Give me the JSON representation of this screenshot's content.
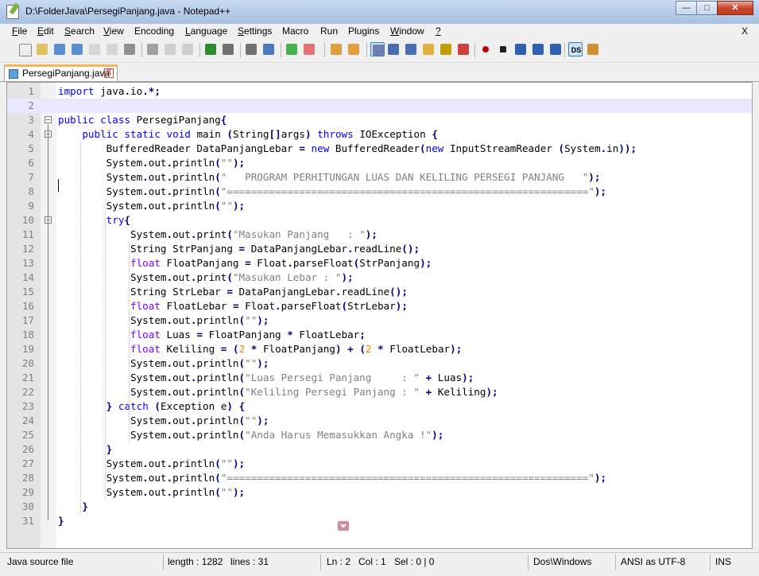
{
  "window": {
    "title": "D:\\FolderJava\\PersegiPanjang.java - Notepad++"
  },
  "menu": [
    {
      "label": "File",
      "ul": "F",
      "rest": "ile"
    },
    {
      "label": "Edit",
      "ul": "E",
      "rest": "dit"
    },
    {
      "label": "Search",
      "ul": "S",
      "rest": "earch"
    },
    {
      "label": "View",
      "ul": "V",
      "rest": "iew"
    },
    {
      "label": "Encoding",
      "ul": "",
      "rest": "Encoding"
    },
    {
      "label": "Language",
      "ul": "L",
      "rest": "anguage"
    },
    {
      "label": "Settings",
      "ul": "S",
      "rest": "ettings"
    },
    {
      "label": "Macro",
      "ul": "",
      "rest": "Macro"
    },
    {
      "label": "Run",
      "ul": "",
      "rest": "Run"
    },
    {
      "label": "Plugins",
      "ul": "",
      "rest": "Plugins"
    },
    {
      "label": "Window",
      "ul": "W",
      "rest": "indow"
    },
    {
      "label": "?",
      "ul": "?",
      "rest": ""
    }
  ],
  "menu_close": "X",
  "toolbar_icons": [
    "new-file-icon",
    "open-file-icon",
    "save-icon",
    "save-all-icon",
    "close-icon",
    "close-all-icon",
    "print-icon",
    "cut-icon",
    "copy-icon",
    "paste-icon",
    "undo-icon",
    "redo-icon",
    "find-icon",
    "replace-icon",
    "zoom-in-icon",
    "zoom-out-icon",
    "sync-vertical-icon",
    "sync-horizontal-icon",
    "word-wrap-icon",
    "show-all-chars-icon",
    "indent-guide-icon",
    "user-defined-lang-icon",
    "doc-map-icon",
    "function-list-icon",
    "record-macro-icon",
    "stop-record-icon",
    "play-macro-icon",
    "run-macro-multiple-icon",
    "save-macro-icon",
    "ds-plugin-icon",
    "plugin-icon"
  ],
  "tab": {
    "label": "PersegiPanjang.java",
    "close": "X"
  },
  "editor": {
    "lines": [
      "import java.io.*;",
      "",
      "public class PersegiPanjang{",
      "    public static void main (String[]args) throws IOException {",
      "        BufferedReader DataPanjangLebar = new BufferedReader(new InputStreamReader (System.in));",
      "        System.out.println(\"\");",
      "        System.out.println(\"   PROGRAM PERHITUNGAN LUAS DAN KELILING PERSEGI PANJANG   \");",
      "        System.out.println(\"============================================================\");",
      "        System.out.println(\"\");",
      "        try{",
      "            System.out.print(\"Masukan Panjang   : \");",
      "            String StrPanjang = DataPanjangLebar.readLine();",
      "            float FloatPanjang = Float.parseFloat(StrPanjang);",
      "            System.out.print(\"Masukan Lebar : \");",
      "            String StrLebar = DataPanjangLebar.readLine();",
      "            float FloatLebar = Float.parseFloat(StrLebar);",
      "            System.out.println(\"\");",
      "            float Luas = FloatPanjang * FloatLebar;",
      "            float Keliling = (2 * FloatPanjang) + (2 * FloatLebar);",
      "            System.out.println(\"\");",
      "            System.out.println(\"Luas Persegi Panjang     : \" + Luas);",
      "            System.out.println(\"Keliling Persegi Panjang : \" + Keliling);",
      "        } catch (Exception e) {",
      "            System.out.println(\"\");",
      "            System.out.println(\"Anda Harus Memasukkan Angka !\");",
      "        }",
      "        System.out.println(\"\");",
      "        System.out.println(\"============================================================\");",
      "        System.out.println(\"\");",
      "    }",
      "}"
    ],
    "current_line": 2,
    "colors": {
      "keyword": "#0000ff",
      "type": "#8000ff",
      "string": "#808080",
      "default": "#000080",
      "number": "#ff8000",
      "current_line_bg": "#e8e8ff"
    }
  },
  "status": {
    "file_type": "Java source file",
    "length": "length : 1282",
    "lines": "lines : 31",
    "ln": "Ln : 2",
    "col": "Col : 1",
    "sel": "Sel : 0 | 0",
    "eol": "Dos\\Windows",
    "encoding": "ANSI as UTF-8",
    "mode": "INS"
  }
}
